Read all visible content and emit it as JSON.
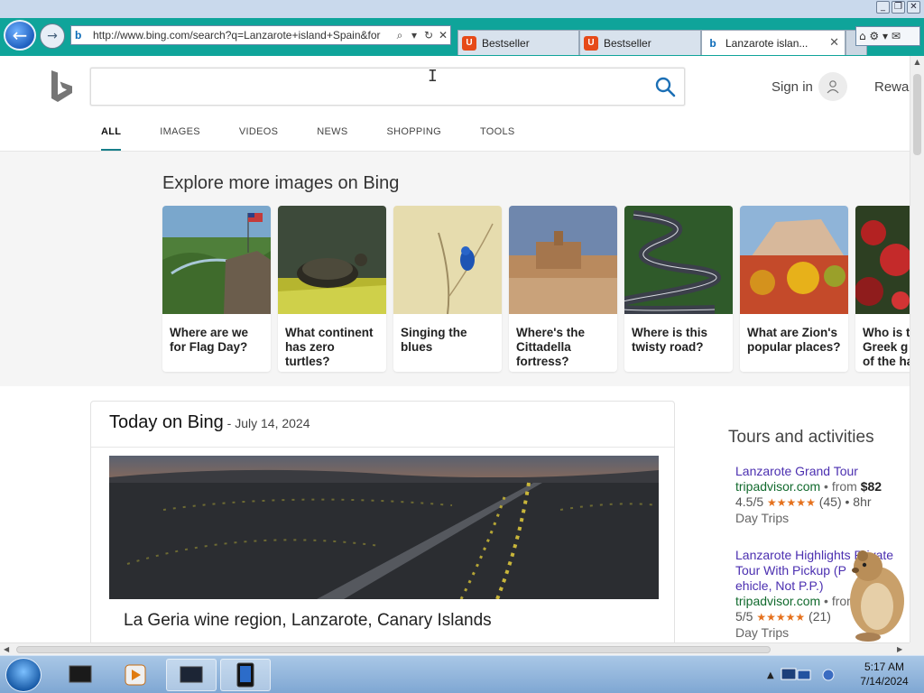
{
  "browser": {
    "address_url": "http://www.bing.com/search?q=Lanzarote+island+Spain&for",
    "tabs": [
      {
        "label": "Bestseller",
        "icon": "shopping-bag-icon"
      },
      {
        "label": "Bestseller",
        "icon": "shopping-bag-icon"
      },
      {
        "label": "Lanzarote islan...",
        "icon": "bing-icon",
        "active": true
      }
    ],
    "window_buttons": [
      "_",
      "❐",
      "✕"
    ],
    "home_label": "⌂ ⚙ ▾ ✉"
  },
  "bing": {
    "search_value": "",
    "sign_in": "Sign in",
    "rewards": "Rewa",
    "scopes": [
      "ALL",
      "IMAGES",
      "VIDEOS",
      "NEWS",
      "SHOPPING",
      "TOOLS"
    ],
    "active_scope": "ALL",
    "accent": "#177e89"
  },
  "explore": {
    "title": "Explore more images on Bing",
    "cards": [
      {
        "line1": "Where are we",
        "line2": "for Flag Day?",
        "line3": ""
      },
      {
        "line1": "What continent",
        "line2": "has zero",
        "line3": "turtles?"
      },
      {
        "line1": "Singing the",
        "line2": "blues",
        "line3": ""
      },
      {
        "line1": "Where's the",
        "line2": "Cittadella",
        "line3": "fortress?"
      },
      {
        "line1": "Where is this",
        "line2": "twisty road?",
        "line3": ""
      },
      {
        "line1": "What are Zion's",
        "line2": "popular places?",
        "line3": ""
      },
      {
        "line1": "Who is t",
        "line2": "Greek g",
        "line3": "of the ha"
      }
    ]
  },
  "today": {
    "title": "Today on Bing",
    "date": " - July 14, 2024",
    "caption": "La Geria wine region, Lanzarote, Canary Islands"
  },
  "tours": {
    "title": "Tours and activities",
    "items": [
      {
        "name_lines": [
          "Lanzarote Grand Tour"
        ],
        "site": "tripadvisor.com",
        "from": " • from ",
        "price": "$82",
        "rating": "4.5/5",
        "stars": "★★★★★",
        "count": "(45)",
        "duration": " • 8hr",
        "category": "Day Trips"
      },
      {
        "name_lines": [
          "Lanzarote Highlights Private",
          "Tour With Pickup (P",
          "ehicle, Not P.P.)"
        ],
        "site": "tripadvisor.com",
        "from": " • from",
        "price": "",
        "rating": "5/5",
        "stars": "★★★★★",
        "count": "(21)",
        "duration": "",
        "category": "Day Trips"
      }
    ]
  },
  "taskbar": {
    "time": "5:17 AM",
    "date": "7/14/2024"
  }
}
